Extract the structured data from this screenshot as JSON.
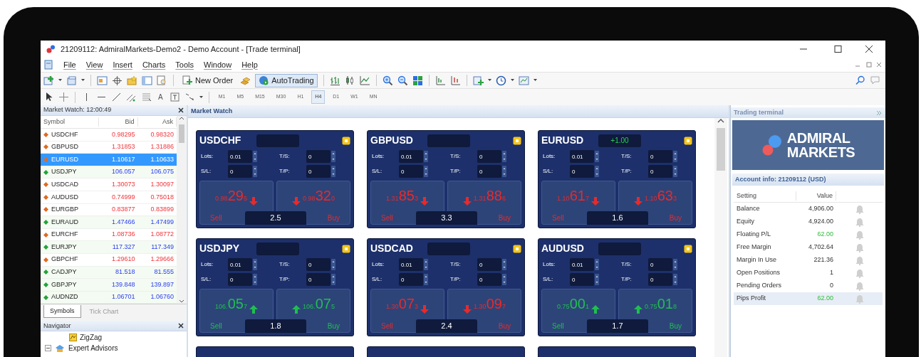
{
  "window": {
    "title": "21209112: AdmiralMarkets-Demo2 - Demo Account - [Trade terminal]"
  },
  "menu": [
    "File",
    "View",
    "Insert",
    "Charts",
    "Tools",
    "Window",
    "Help"
  ],
  "toolbar": {
    "new_order": "New Order",
    "auto_trading": "AutoTrading",
    "text_tool": "A",
    "timeframes": [
      {
        "label": "M1",
        "selected": false
      },
      {
        "label": "M5",
        "selected": false
      },
      {
        "label": "M15",
        "selected": false
      },
      {
        "label": "M30",
        "selected": false
      },
      {
        "label": "H1",
        "selected": false
      },
      {
        "label": "H4",
        "selected": true
      },
      {
        "label": "D1",
        "selected": false
      },
      {
        "label": "W1",
        "selected": false
      },
      {
        "label": "MN",
        "selected": false
      }
    ]
  },
  "market_watch": {
    "title": "Market Watch: 12:00:49",
    "columns": [
      "Symbol",
      "Bid",
      "Ask"
    ],
    "rows": [
      {
        "symbol": "USDCHF",
        "bid": "0.98295",
        "ask": "0.98320",
        "rising": false,
        "selected": false
      },
      {
        "symbol": "GBPUSD",
        "bid": "1.31853",
        "ask": "1.31886",
        "rising": false,
        "selected": false
      },
      {
        "symbol": "EURUSD",
        "bid": "1.10617",
        "ask": "1.10633",
        "rising": false,
        "selected": true
      },
      {
        "symbol": "USDJPY",
        "bid": "106.057",
        "ask": "106.075",
        "rising": true,
        "selected": false
      },
      {
        "symbol": "USDCAD",
        "bid": "1.30073",
        "ask": "1.30097",
        "rising": false,
        "selected": false
      },
      {
        "symbol": "AUDUSD",
        "bid": "0.74999",
        "ask": "0.75018",
        "rising": false,
        "selected": false
      },
      {
        "symbol": "EURGBP",
        "bid": "0.83877",
        "ask": "0.83899",
        "rising": false,
        "selected": false
      },
      {
        "symbol": "EURAUD",
        "bid": "1.47466",
        "ask": "1.47499",
        "rising": true,
        "selected": false
      },
      {
        "symbol": "EURCHF",
        "bid": "1.08736",
        "ask": "1.08772",
        "rising": false,
        "selected": false
      },
      {
        "symbol": "EURJPY",
        "bid": "117.327",
        "ask": "117.349",
        "rising": true,
        "selected": false
      },
      {
        "symbol": "GBPCHF",
        "bid": "1.29610",
        "ask": "1.29666",
        "rising": false,
        "selected": false
      },
      {
        "symbol": "CADJPY",
        "bid": "81.518",
        "ask": "81.555",
        "rising": true,
        "selected": false
      },
      {
        "symbol": "GBPJPY",
        "bid": "139.848",
        "ask": "139.897",
        "rising": true,
        "selected": false
      },
      {
        "symbol": "AUDNZD",
        "bid": "1.06701",
        "ask": "1.06760",
        "rising": true,
        "selected": false
      }
    ],
    "tabs": [
      {
        "label": "Symbols",
        "selected": true
      },
      {
        "label": "Tick Chart",
        "selected": false
      }
    ]
  },
  "navigator": {
    "title": "Navigator",
    "items": [
      {
        "label": "ZigZag",
        "kind": "indicator"
      },
      {
        "label": "Expert Advisors",
        "kind": "folder"
      }
    ]
  },
  "trade_panel": {
    "title": "Market Watch",
    "cards": [
      {
        "symbol": "USDCHF",
        "fields": [
          {
            "label": "Lots:",
            "value": "0.01"
          },
          {
            "label": "T/S:",
            "value": "0"
          },
          {
            "label": "S/L:",
            "value": "0"
          },
          {
            "label": "T/P:",
            "value": "0"
          }
        ],
        "sell": {
          "pre": "0.98",
          "big": "29",
          "post": "5"
        },
        "buy": {
          "pre": "0.98",
          "big": "32",
          "post": "0"
        },
        "rising": false,
        "spread": "2.5",
        "sell_label": "Sell",
        "buy_label": "Buy"
      },
      {
        "symbol": "GBPUSD",
        "fields": [
          {
            "label": "Lots:",
            "value": "0.01"
          },
          {
            "label": "T/S:",
            "value": "0"
          },
          {
            "label": "S/L:",
            "value": "0"
          },
          {
            "label": "T/P:",
            "value": "0"
          }
        ],
        "sell": {
          "pre": "1.31",
          "big": "85",
          "post": "3"
        },
        "buy": {
          "pre": "1.31",
          "big": "88",
          "post": "6"
        },
        "rising": false,
        "spread": "3.3",
        "sell_label": "Sell",
        "buy_label": "Buy"
      },
      {
        "symbol": "EURUSD",
        "change": "+1.00",
        "fields": [
          {
            "label": "Lots:",
            "value": "0.01"
          },
          {
            "label": "T/S:",
            "value": "0"
          },
          {
            "label": "S/L:",
            "value": "0"
          },
          {
            "label": "T/P:",
            "value": "0"
          }
        ],
        "sell": {
          "pre": "1.10",
          "big": "61",
          "post": "7"
        },
        "buy": {
          "pre": "1.10",
          "big": "63",
          "post": "3"
        },
        "rising": false,
        "spread": "1.6",
        "sell_label": "Sell",
        "buy_label": "Buy"
      },
      {
        "symbol": "USDJPY",
        "fields": [
          {
            "label": "Lots:",
            "value": "0.01"
          },
          {
            "label": "T/S:",
            "value": "0"
          },
          {
            "label": "S/L:",
            "value": "0"
          },
          {
            "label": "T/P:",
            "value": "0"
          }
        ],
        "sell": {
          "pre": "106.",
          "big": "05",
          "post": "7"
        },
        "buy": {
          "pre": "106.",
          "big": "07",
          "post": "5"
        },
        "rising": true,
        "spread": "1.8",
        "sell_label": "Sell",
        "buy_label": "Buy"
      },
      {
        "symbol": "USDCAD",
        "fields": [
          {
            "label": "Lots:",
            "value": "0.01"
          },
          {
            "label": "T/S:",
            "value": "0"
          },
          {
            "label": "S/L:",
            "value": "0"
          },
          {
            "label": "T/P:",
            "value": "0"
          }
        ],
        "sell": {
          "pre": "1.30",
          "big": "07",
          "post": "3"
        },
        "buy": {
          "pre": "1.30",
          "big": "09",
          "post": "7"
        },
        "rising": false,
        "spread": "2.4",
        "sell_label": "Sell",
        "buy_label": "Buy"
      },
      {
        "symbol": "AUDUSD",
        "fields": [
          {
            "label": "Lots:",
            "value": "0.01"
          },
          {
            "label": "T/S:",
            "value": "0"
          },
          {
            "label": "S/L:",
            "value": "0"
          },
          {
            "label": "T/P:",
            "value": "0"
          }
        ],
        "sell": {
          "pre": "0.75",
          "big": "00",
          "post": "1"
        },
        "buy": {
          "pre": "0.75",
          "big": "01",
          "post": "8"
        },
        "rising": true,
        "spread": "1.7",
        "sell_label": "Sell",
        "buy_label": "Buy"
      }
    ]
  },
  "terminal": {
    "title": "Trading terminal",
    "logo": [
      "ADMIRAL",
      "MARKETS"
    ],
    "account_title": "Account info: 21209112 (USD)",
    "columns": [
      "Setting",
      "Value"
    ],
    "rows": [
      {
        "setting": "Balance",
        "value": "4,906.00",
        "profit": false,
        "selected": false
      },
      {
        "setting": "Equity",
        "value": "4,924.00",
        "profit": false,
        "selected": false
      },
      {
        "setting": "Floating P/L",
        "value": "62.00",
        "profit": true,
        "selected": false
      },
      {
        "setting": "Free Margin",
        "value": "4,702.64",
        "profit": false,
        "selected": false
      },
      {
        "setting": "Margin In Use",
        "value": "221.36",
        "profit": false,
        "selected": false
      },
      {
        "setting": "Open Positions",
        "value": "1",
        "profit": false,
        "selected": false
      },
      {
        "setting": "Pending Orders",
        "value": "0",
        "profit": false,
        "selected": false
      },
      {
        "setting": "Pips Profit",
        "value": "62.00",
        "profit": true,
        "selected": true
      }
    ]
  }
}
